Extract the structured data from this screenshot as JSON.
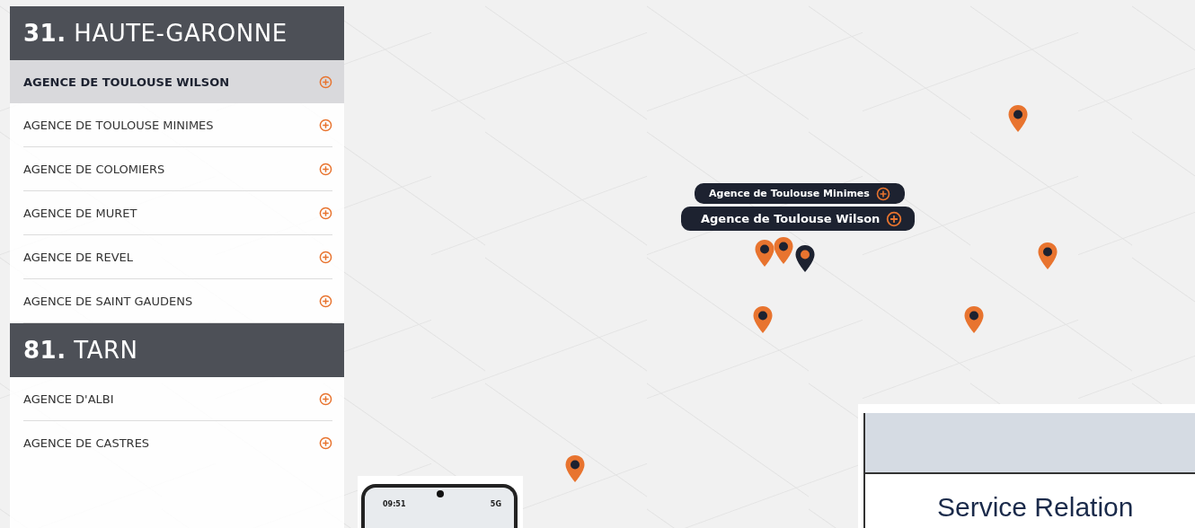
{
  "regions": [
    {
      "number": "31.",
      "name": "HAUTE-GARONNE",
      "agencies": [
        {
          "name": "AGENCE DE TOULOUSE WILSON",
          "selected": true
        },
        {
          "name": "AGENCE DE TOULOUSE MINIMES",
          "selected": false
        },
        {
          "name": "AGENCE DE COLOMIERS",
          "selected": false
        },
        {
          "name": "AGENCE DE MURET",
          "selected": false
        },
        {
          "name": "AGENCE DE REVEL",
          "selected": false
        },
        {
          "name": "AGENCE DE SAINT GAUDENS",
          "selected": false
        }
      ]
    },
    {
      "number": "81.",
      "name": "TARN",
      "agencies": [
        {
          "name": "AGENCE D'ALBI",
          "selected": false
        },
        {
          "name": "AGENCE DE CASTRES",
          "selected": false
        }
      ]
    }
  ],
  "map": {
    "pins": [
      {
        "selected": false
      },
      {
        "selected": false
      },
      {
        "selected": false
      },
      {
        "selected": false
      },
      {
        "selected": false
      },
      {
        "selected": false
      },
      {
        "selected": false
      },
      {
        "selected": true
      }
    ],
    "popups": [
      {
        "label": "Agence de Toulouse Minimes",
        "selected": false
      },
      {
        "label": "Agence de Toulouse Wilson",
        "selected": true
      }
    ]
  },
  "phone": {
    "time": "09:51",
    "network": "5G"
  },
  "card": {
    "title": "Service Relation"
  }
}
